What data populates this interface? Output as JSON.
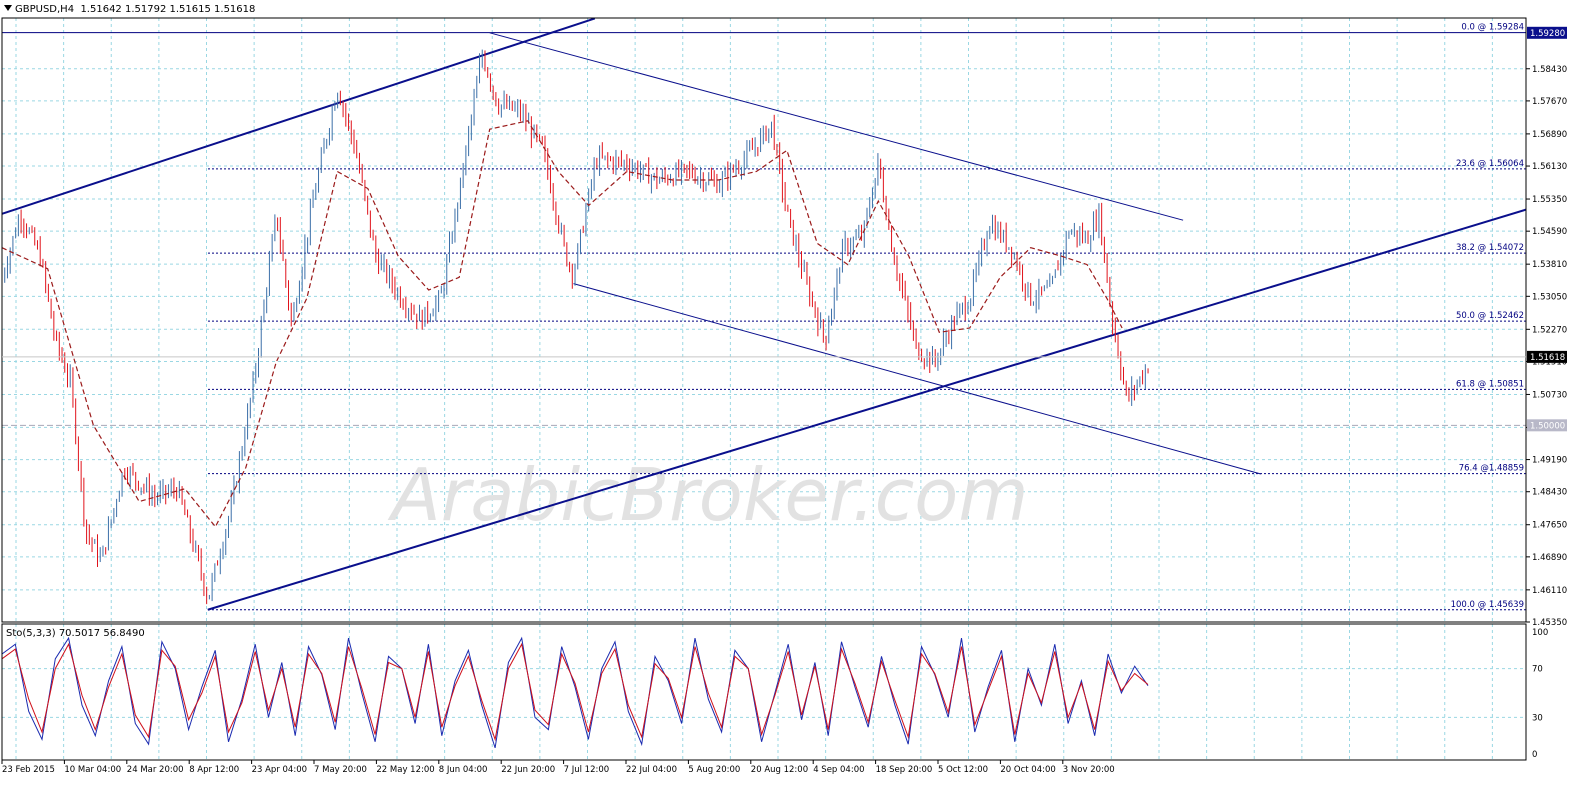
{
  "header": {
    "symbol": "GBPUSD,H4",
    "ohlc": "1.51642 1.51792 1.51615 1.51618"
  },
  "stoch_header": "Sto(5,3,3) 70.5017 56.8490",
  "watermark": "ArabicBroker.com",
  "colors": {
    "background": "#ffffff",
    "grid": "#9ad7e3",
    "frame": "#000000",
    "bull": "#3b6fa8",
    "bear": "#e0131b",
    "ma": "#9b1a1a",
    "trendline": "#0a0f8c",
    "fibo": "#000080",
    "stoch_main": "#1a2ab0",
    "stoch_signal": "#d0101a"
  },
  "chart_data": [
    {
      "type": "candlestick",
      "title": "",
      "ylim": [
        1.4535,
        1.5963
      ],
      "y_ticks": [
        "1.58430",
        "1.57670",
        "1.56890",
        "1.56130",
        "1.55350",
        "1.54590",
        "1.53810",
        "1.53050",
        "1.52270",
        "1.51510",
        "1.50730",
        "1.49950",
        "1.49190",
        "1.48430",
        "1.47650",
        "1.46890",
        "1.46110",
        "1.45350"
      ],
      "x_ticks": [
        "23 Feb 2015",
        "10 Mar 04:00",
        "24 Mar 20:00",
        "8 Apr 12:00",
        "23 Apr 04:00",
        "7 May 20:00",
        "22 May 12:00",
        "8 Jun 04:00",
        "22 Jun 20:00",
        "7 Jul 12:00",
        "22 Jul 04:00",
        "5 Aug 20:00",
        "20 Aug 12:00",
        "4 Sep 04:00",
        "18 Sep 20:00",
        "5 Oct 12:00",
        "20 Oct 04:00",
        "3 Nov 20:00"
      ],
      "price_path": [
        {
          "t": 0,
          "p": 1.535
        },
        {
          "t": 0.012,
          "p": 1.55
        },
        {
          "t": 0.025,
          "p": 1.54
        },
        {
          "t": 0.035,
          "p": 1.52
        },
        {
          "t": 0.045,
          "p": 1.51
        },
        {
          "t": 0.055,
          "p": 1.475
        },
        {
          "t": 0.065,
          "p": 1.468
        },
        {
          "t": 0.08,
          "p": 1.49
        },
        {
          "t": 0.1,
          "p": 1.483
        },
        {
          "t": 0.115,
          "p": 1.485
        },
        {
          "t": 0.13,
          "p": 1.466
        },
        {
          "t": 0.135,
          "p": 1.459
        },
        {
          "t": 0.15,
          "p": 1.48
        },
        {
          "t": 0.165,
          "p": 1.51
        },
        {
          "t": 0.18,
          "p": 1.55
        },
        {
          "t": 0.19,
          "p": 1.524
        },
        {
          "t": 0.205,
          "p": 1.555
        },
        {
          "t": 0.22,
          "p": 1.58
        },
        {
          "t": 0.232,
          "p": 1.565
        },
        {
          "t": 0.245,
          "p": 1.54
        },
        {
          "t": 0.262,
          "p": 1.53
        },
        {
          "t": 0.275,
          "p": 1.525
        },
        {
          "t": 0.288,
          "p": 1.53
        },
        {
          "t": 0.3,
          "p": 1.555
        },
        {
          "t": 0.315,
          "p": 1.588
        },
        {
          "t": 0.325,
          "p": 1.576
        },
        {
          "t": 0.34,
          "p": 1.574
        },
        {
          "t": 0.355,
          "p": 1.565
        },
        {
          "t": 0.37,
          "p": 1.54
        },
        {
          "t": 0.375,
          "p": 1.536
        },
        {
          "t": 0.39,
          "p": 1.563
        },
        {
          "t": 0.41,
          "p": 1.562
        },
        {
          "t": 0.43,
          "p": 1.558
        },
        {
          "t": 0.45,
          "p": 1.56
        },
        {
          "t": 0.47,
          "p": 1.557
        },
        {
          "t": 0.49,
          "p": 1.564
        },
        {
          "t": 0.505,
          "p": 1.571
        },
        {
          "t": 0.515,
          "p": 1.55
        },
        {
          "t": 0.528,
          "p": 1.533
        },
        {
          "t": 0.54,
          "p": 1.52
        },
        {
          "t": 0.552,
          "p": 1.542
        },
        {
          "t": 0.565,
          "p": 1.545
        },
        {
          "t": 0.575,
          "p": 1.562
        },
        {
          "t": 0.585,
          "p": 1.54
        },
        {
          "t": 0.6,
          "p": 1.518
        },
        {
          "t": 0.612,
          "p": 1.515
        },
        {
          "t": 0.625,
          "p": 1.525
        },
        {
          "t": 0.635,
          "p": 1.53
        },
        {
          "t": 0.648,
          "p": 1.548
        },
        {
          "t": 0.662,
          "p": 1.542
        },
        {
          "t": 0.675,
          "p": 1.53
        },
        {
          "t": 0.688,
          "p": 1.532
        },
        {
          "t": 0.7,
          "p": 1.546
        },
        {
          "t": 0.712,
          "p": 1.544
        },
        {
          "t": 0.72,
          "p": 1.55
        },
        {
          "t": 0.728,
          "p": 1.526
        },
        {
          "t": 0.738,
          "p": 1.506
        },
        {
          "t": 0.745,
          "p": 1.51
        },
        {
          "t": 0.752,
          "p": 1.514
        }
      ],
      "moving_average_path": [
        {
          "t": 0,
          "p": 1.542
        },
        {
          "t": 0.03,
          "p": 1.537
        },
        {
          "t": 0.06,
          "p": 1.5
        },
        {
          "t": 0.09,
          "p": 1.482
        },
        {
          "t": 0.12,
          "p": 1.485
        },
        {
          "t": 0.14,
          "p": 1.476
        },
        {
          "t": 0.16,
          "p": 1.49
        },
        {
          "t": 0.18,
          "p": 1.515
        },
        {
          "t": 0.2,
          "p": 1.53
        },
        {
          "t": 0.22,
          "p": 1.56
        },
        {
          "t": 0.24,
          "p": 1.556
        },
        {
          "t": 0.26,
          "p": 1.54
        },
        {
          "t": 0.28,
          "p": 1.532
        },
        {
          "t": 0.3,
          "p": 1.535
        },
        {
          "t": 0.32,
          "p": 1.57
        },
        {
          "t": 0.345,
          "p": 1.572
        },
        {
          "t": 0.365,
          "p": 1.56
        },
        {
          "t": 0.385,
          "p": 1.552
        },
        {
          "t": 0.41,
          "p": 1.56
        },
        {
          "t": 0.44,
          "p": 1.558
        },
        {
          "t": 0.47,
          "p": 1.558
        },
        {
          "t": 0.495,
          "p": 1.56
        },
        {
          "t": 0.515,
          "p": 1.565
        },
        {
          "t": 0.535,
          "p": 1.543
        },
        {
          "t": 0.555,
          "p": 1.538
        },
        {
          "t": 0.575,
          "p": 1.553
        },
        {
          "t": 0.595,
          "p": 1.54
        },
        {
          "t": 0.615,
          "p": 1.522
        },
        {
          "t": 0.635,
          "p": 1.523
        },
        {
          "t": 0.655,
          "p": 1.535
        },
        {
          "t": 0.675,
          "p": 1.542
        },
        {
          "t": 0.695,
          "p": 1.54
        },
        {
          "t": 0.712,
          "p": 1.538
        },
        {
          "t": 0.725,
          "p": 1.53
        },
        {
          "t": 0.735,
          "p": 1.523
        }
      ],
      "fibonacci_levels": [
        {
          "label": "0.0 @ 1.59284",
          "value": 1.59284
        },
        {
          "label": "23.6 @ 1.56064",
          "value": 1.56064
        },
        {
          "label": "38.2 @ 1.54072",
          "value": 1.54072
        },
        {
          "label": "50.0 @ 1.52462",
          "value": 1.52462
        },
        {
          "label": "61.8 @ 1.50851",
          "value": 1.50851
        },
        {
          "label": "76.4 @1.48859",
          "value": 1.48859
        },
        {
          "label": "100.0 @ 1.45639",
          "value": 1.45639
        }
      ],
      "current_price": "1.51618",
      "level_marker": "1.50000",
      "top_marker": "1.59280"
    },
    {
      "type": "line",
      "name": "Sto(5,3,3)",
      "ylim": [
        0,
        100
      ],
      "y_ticks": [
        "100",
        "70",
        "30",
        "0"
      ],
      "series": [
        {
          "name": "main",
          "values": [
            82,
            90,
            35,
            12,
            78,
            95,
            40,
            15,
            60,
            88,
            25,
            8,
            92,
            70,
            20,
            55,
            85,
            10,
            45,
            90,
            30,
            75,
            15,
            88,
            65,
            20,
            95,
            50,
            10,
            80,
            70,
            25,
            90,
            15,
            60,
            85,
            40,
            5,
            75,
            95,
            30,
            20,
            88,
            55,
            12,
            70,
            92,
            35,
            8,
            80,
            60,
            25,
            95,
            45,
            18,
            85,
            70,
            10,
            50,
            90,
            28,
            75,
            15,
            92,
            55,
            22,
            80,
            40,
            8,
            88,
            65,
            30,
            95,
            18,
            55,
            85,
            10,
            70,
            40,
            90,
            25,
            60,
            15,
            82,
            50,
            72,
            56
          ]
        },
        {
          "name": "signal",
          "values": [
            78,
            86,
            45,
            18,
            70,
            90,
            48,
            20,
            55,
            82,
            32,
            14,
            85,
            72,
            28,
            50,
            80,
            18,
            42,
            84,
            36,
            70,
            22,
            82,
            66,
            26,
            88,
            54,
            16,
            75,
            70,
            30,
            84,
            22,
            56,
            80,
            44,
            12,
            70,
            90,
            36,
            24,
            82,
            58,
            18,
            66,
            86,
            40,
            14,
            74,
            62,
            30,
            88,
            50,
            22,
            80,
            70,
            16,
            48,
            84,
            32,
            72,
            20,
            86,
            58,
            26,
            76,
            44,
            14,
            82,
            66,
            34,
            88,
            24,
            52,
            80,
            16,
            66,
            42,
            84,
            30,
            58,
            20,
            76,
            52,
            66,
            57
          ]
        }
      ]
    }
  ]
}
